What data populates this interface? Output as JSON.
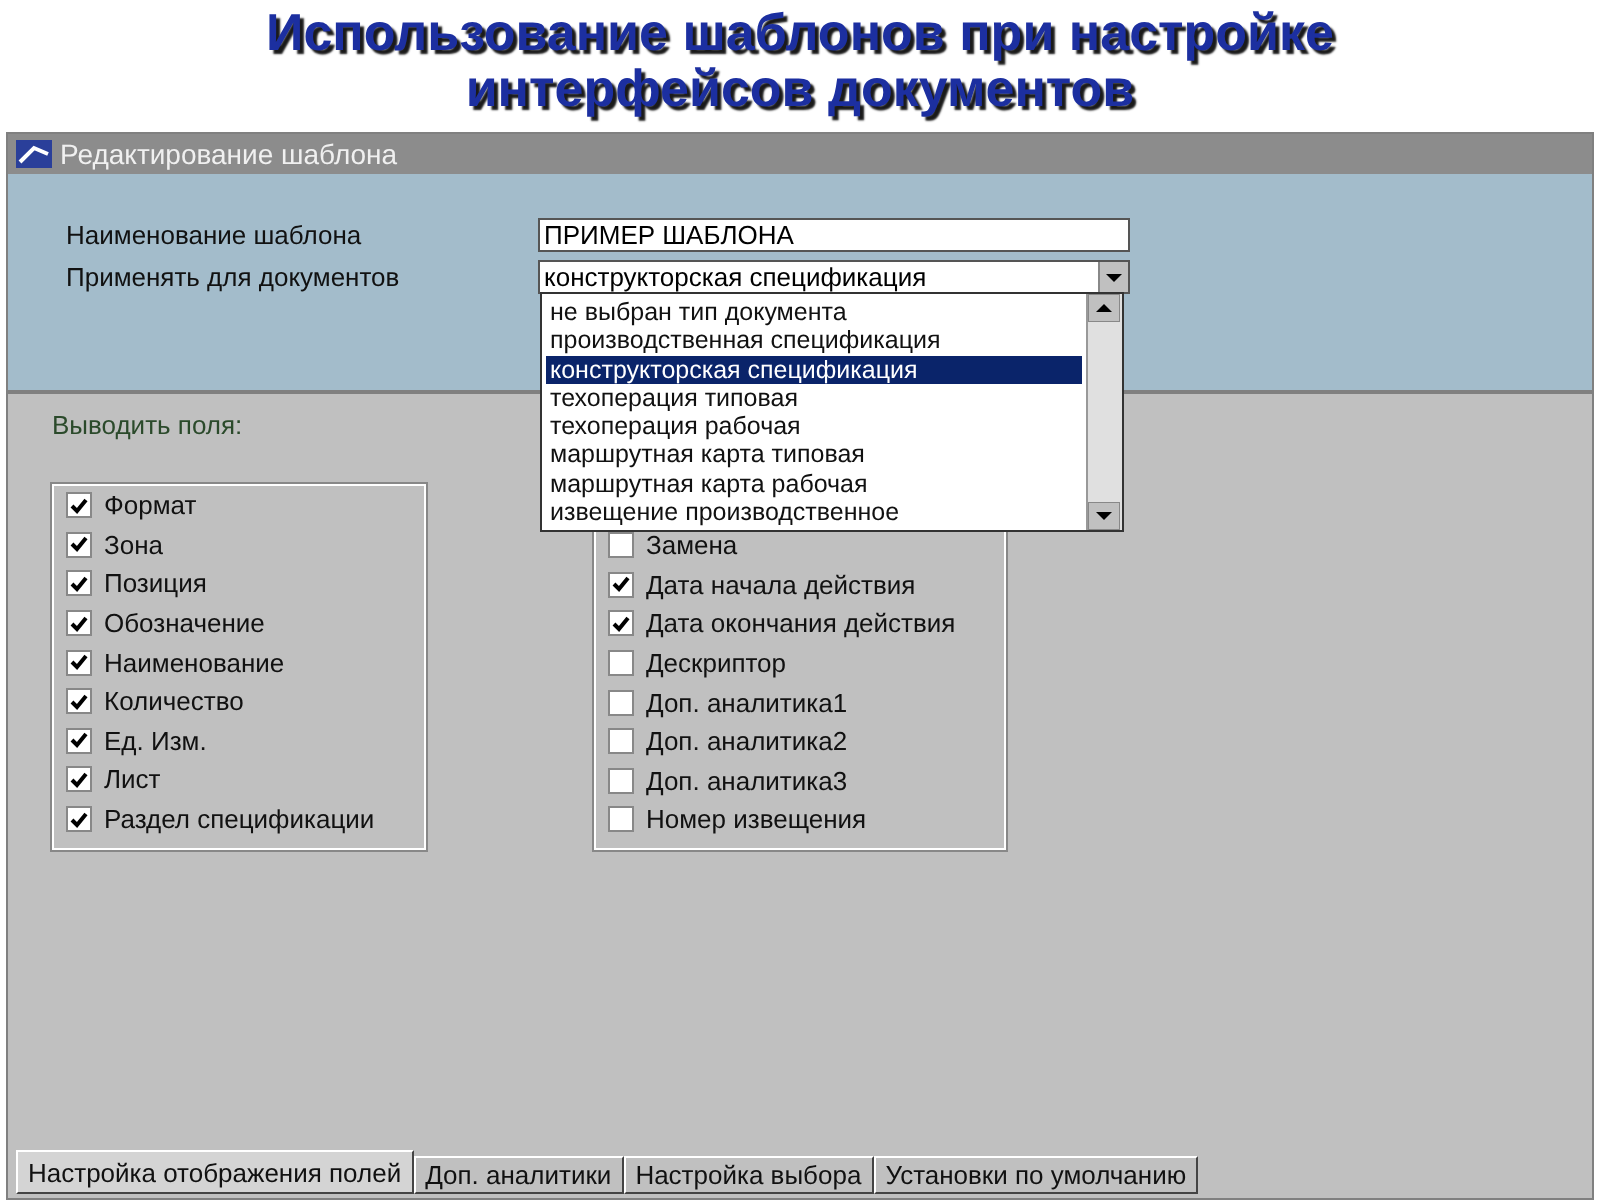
{
  "slide_title": "Использование шаблонов при настройке интерфейсов документов",
  "window": {
    "title": "Редактирование шаблона"
  },
  "form": {
    "name_label": "Наименование шаблона",
    "name_value": "ПРИМЕР ШАБЛОНА",
    "apply_label": "Применять для документов",
    "apply_value": "конструкторская спецификация",
    "dropdown_options": [
      {
        "label": "не выбран тип документа",
        "selected": false
      },
      {
        "label": "производственная спецификация",
        "selected": false
      },
      {
        "label": "конструкторская спецификация",
        "selected": true
      },
      {
        "label": "техоперация типовая",
        "selected": false
      },
      {
        "label": "техоперация рабочая",
        "selected": false
      },
      {
        "label": "маршрутная карта типовая",
        "selected": false
      },
      {
        "label": "маршрутная карта рабочая",
        "selected": false
      },
      {
        "label": "извещение производственное",
        "selected": false
      }
    ]
  },
  "fields_label": "Выводить поля:",
  "fields_left": [
    {
      "label": "Формат",
      "checked": true
    },
    {
      "label": "Зона",
      "checked": true
    },
    {
      "label": "Позиция",
      "checked": true
    },
    {
      "label": "Обозначение",
      "checked": true
    },
    {
      "label": "Наименование",
      "checked": true
    },
    {
      "label": "Количество",
      "checked": true
    },
    {
      "label": "Ед. Изм.",
      "checked": true
    },
    {
      "label": "Лист",
      "checked": true
    },
    {
      "label": "Раздел спецификации",
      "checked": true
    }
  ],
  "fields_right": [
    {
      "label": "Замена",
      "checked": false
    },
    {
      "label": "Дата начала действия",
      "checked": true
    },
    {
      "label": "Дата окончания действия",
      "checked": true
    },
    {
      "label": "Дескриптор",
      "checked": false
    },
    {
      "label": "Доп. аналитика1",
      "checked": false
    },
    {
      "label": "Доп. аналитика2",
      "checked": false
    },
    {
      "label": "Доп. аналитика3",
      "checked": false
    },
    {
      "label": "Номер извещения",
      "checked": false
    }
  ],
  "tabs": [
    {
      "label": "Настройка отображения полей",
      "selected": true
    },
    {
      "label": "Доп. аналитики",
      "selected": false
    },
    {
      "label": "Настройка выбора",
      "selected": false
    },
    {
      "label": "Установки по умолчанию",
      "selected": false
    }
  ]
}
